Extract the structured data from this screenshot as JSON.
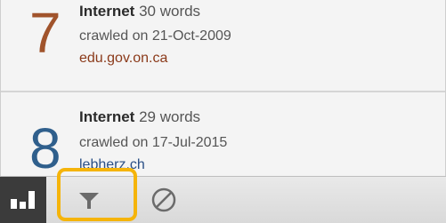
{
  "results": [
    {
      "rank": "7",
      "source": "Internet",
      "word_count": "30 words",
      "crawl_date": "crawled on 21-Oct-2009",
      "url": "edu.gov.on.ca",
      "rank_color": "#a0532b",
      "url_color": "#8b3a1a"
    },
    {
      "rank": "8",
      "source": "Internet",
      "word_count": "29 words",
      "crawl_date": "crawled on 17-Jul-2015",
      "url": "lebherz.ch",
      "rank_color": "#2f5f8c",
      "url_color": "#2a4f86"
    }
  ],
  "toolbar": {
    "chart_icon": "bar-chart-icon",
    "filter_icon": "filter-icon",
    "cancel_icon": "cancel-icon",
    "highlight_color": "#f5b40a"
  }
}
